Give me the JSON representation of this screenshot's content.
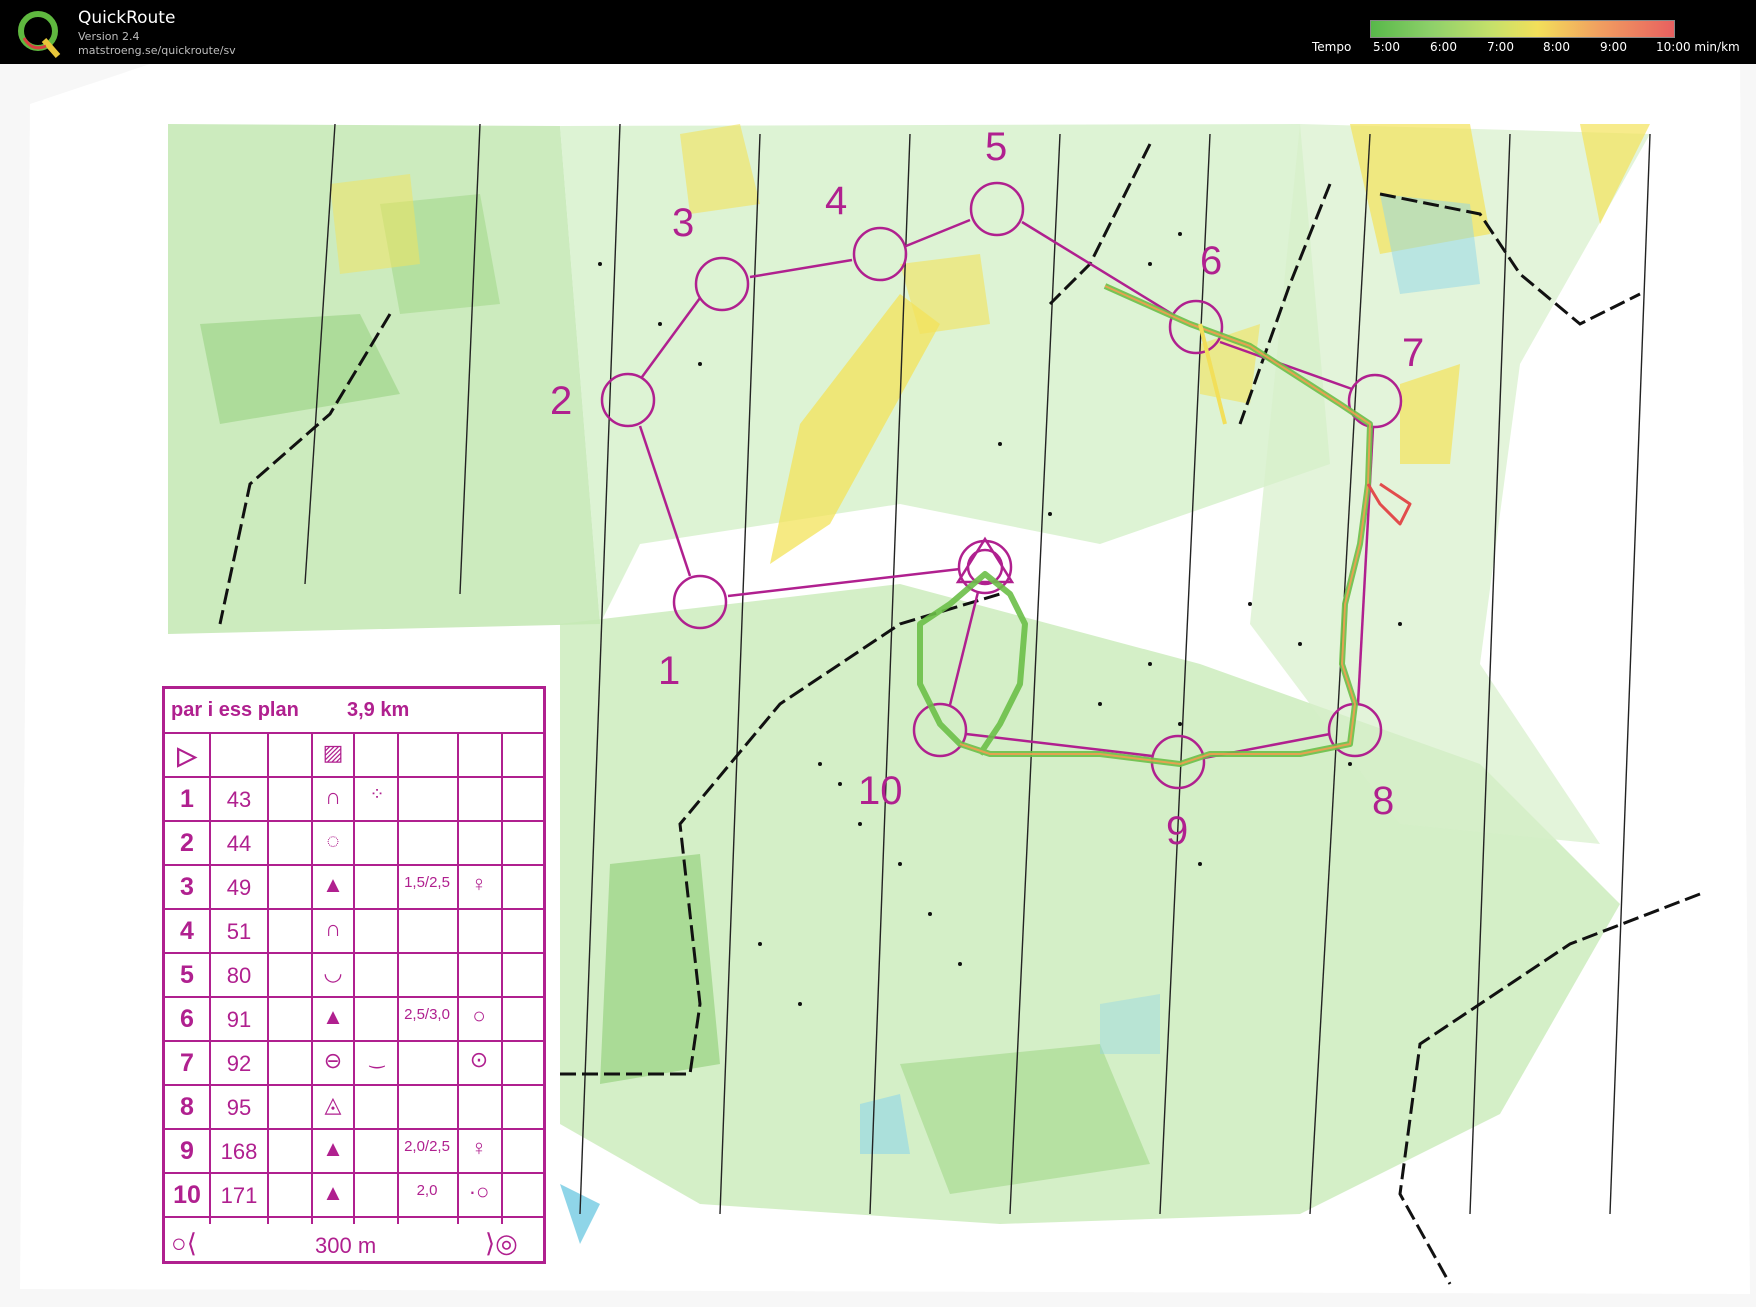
{
  "header": {
    "app_name": "QuickRoute",
    "version": "Version 2.4",
    "url": "matstroeng.se/quickroute/sv",
    "tempo_label": "Tempo",
    "tempo_ticks": [
      "5:00",
      "6:00",
      "7:00",
      "8:00",
      "9:00",
      "10:00 min/km"
    ],
    "tempo_range_min_per_km": [
      5,
      10
    ]
  },
  "map": {
    "control_labels": [
      "1",
      "2",
      "3",
      "4",
      "5",
      "6",
      "7",
      "8",
      "9",
      "10"
    ],
    "colors": {
      "course": "#b0208f",
      "vegetation": "#a9dc93",
      "yellow": "#f3e35a",
      "water": "#8fd5e8",
      "route_good": "#6bbf48",
      "route_slow": "#e24c4c"
    }
  },
  "control_description": {
    "title": "par i ess plan",
    "length": "3,9 km",
    "distance_to_finish": "300 m",
    "rows": [
      {
        "num": "1",
        "code": "43",
        "symbol": "knoll-symbol",
        "symbol2": "dots",
        "dim": "",
        "extra": ""
      },
      {
        "num": "2",
        "code": "44",
        "symbol": "dotted-circle",
        "symbol2": "",
        "dim": "",
        "extra": ""
      },
      {
        "num": "3",
        "code": "49",
        "symbol": "boulder",
        "symbol2": "",
        "dim": "1,5/2,5",
        "extra": "♀"
      },
      {
        "num": "4",
        "code": "51",
        "symbol": "knoll-symbol",
        "symbol2": "",
        "dim": "",
        "extra": ""
      },
      {
        "num": "5",
        "code": "80",
        "symbol": "depression",
        "symbol2": "",
        "dim": "",
        "extra": ""
      },
      {
        "num": "6",
        "code": "91",
        "symbol": "boulder",
        "symbol2": "",
        "dim": "2,5/3,0",
        "extra": "○"
      },
      {
        "num": "7",
        "code": "92",
        "symbol": "ellipse",
        "symbol2": "curve",
        "dim": "",
        "extra": "⊙"
      },
      {
        "num": "8",
        "code": "95",
        "symbol": "triangle-circle",
        "symbol2": "",
        "dim": "",
        "extra": ""
      },
      {
        "num": "9",
        "code": "168",
        "symbol": "boulder",
        "symbol2": "",
        "dim": "2,0/2,5",
        "extra": "♀"
      },
      {
        "num": "10",
        "code": "171",
        "symbol": "boulder",
        "symbol2": "",
        "dim": "2,0",
        "extra": "·○"
      }
    ],
    "symbols_text": {
      "boulder": "▲",
      "knoll-symbol": "∩",
      "depression": "◡",
      "dotted-circle": "◌",
      "ellipse": "⊖",
      "triangle-circle": "◬",
      "dots": "⁘",
      "curve": "‿"
    }
  }
}
